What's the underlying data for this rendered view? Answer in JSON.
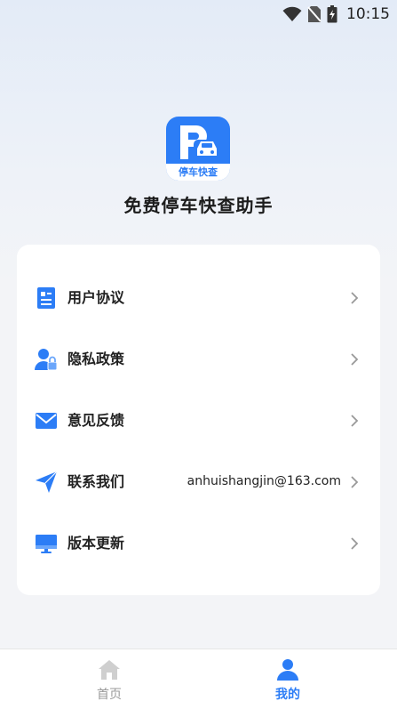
{
  "status_bar": {
    "time": "10:15"
  },
  "app": {
    "logo_text": "停车快查",
    "name": "免费停车快查助手"
  },
  "menu": [
    {
      "label": "用户协议",
      "icon": "document-icon",
      "value": ""
    },
    {
      "label": "隐私政策",
      "icon": "user-lock-icon",
      "value": ""
    },
    {
      "label": "意见反馈",
      "icon": "mail-icon",
      "value": ""
    },
    {
      "label": "联系我们",
      "icon": "send-icon",
      "value": "anhuishangjin@163.com"
    },
    {
      "label": "版本更新",
      "icon": "monitor-icon",
      "value": ""
    }
  ],
  "tabs": [
    {
      "label": "首页",
      "icon": "home-icon",
      "active": false
    },
    {
      "label": "我的",
      "icon": "person-icon",
      "active": true
    }
  ],
  "colors": {
    "accent": "#2c7df6",
    "inactive": "#9a9a9a",
    "card": "#ffffff"
  }
}
